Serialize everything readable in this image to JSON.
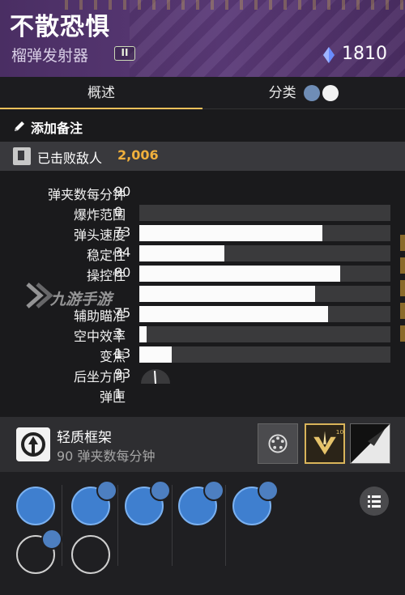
{
  "header": {
    "weapon_name": "不散恐惧",
    "weapon_type": "榴弹发射器",
    "slot_badge": "II",
    "power": "1810"
  },
  "tabs": {
    "overview": "概述",
    "category": "分类"
  },
  "notes": {
    "add_note": "添加备注"
  },
  "tracker": {
    "label": "已击败敌人",
    "count": "2,006"
  },
  "stats": [
    {
      "label": "弹夹数每分钟",
      "value": "90"
    },
    {
      "label": "爆炸范围",
      "value": "0",
      "level": 0
    },
    {
      "label": "弹头速度",
      "value": "73",
      "level": 73
    },
    {
      "label": "稳定性",
      "value": "34",
      "level": 34
    },
    {
      "label": "操控性",
      "value": "80",
      "level": 80
    },
    {
      "label": "",
      "value": "",
      "level": 70
    },
    {
      "label": "辅助瞄准",
      "value": "75",
      "level": 75
    },
    {
      "label": "空中效率",
      "value": "3",
      "level": 3
    },
    {
      "label": "变焦",
      "value": "13",
      "level": 13
    },
    {
      "label": "后坐方向",
      "value": "93"
    },
    {
      "label": "弹匣",
      "value": "1"
    }
  ],
  "watermark": "九游手游",
  "frame": {
    "name": "轻质框架",
    "description": "90 弹夹数每分钟"
  },
  "colors": {
    "header_purple": "#5b3a78",
    "kill_count_gold": "#f0b03c",
    "tab_underline": "#f5c15b",
    "perk_blue": "#3f7fcf"
  },
  "icons": {
    "power": "power-crystal-icon",
    "note": "pencil-icon",
    "tracker": "kill-tracker-icon",
    "frame": "lightweight-frame-icon",
    "list": "list-icon"
  }
}
